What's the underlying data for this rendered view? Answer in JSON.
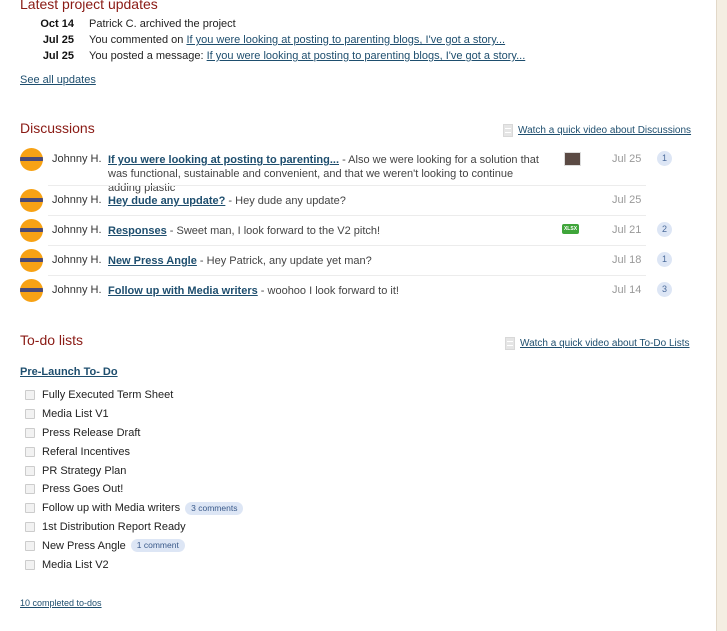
{
  "updates": {
    "title": "Latest project updates",
    "items": [
      {
        "date": "Oct 14",
        "text": "Patrick C. archived the project",
        "link": ""
      },
      {
        "date": "Jul 25",
        "text": "You commented on ",
        "link": "If you were looking at posting to parenting blogs, I've got a story..."
      },
      {
        "date": "Jul 25",
        "text": "You posted a message: ",
        "link": "If you were looking at posting to parenting blogs, I've got a story..."
      }
    ],
    "see_all": "See all updates"
  },
  "discussions": {
    "title": "Discussions",
    "video_link": "Watch a quick video about Discussions",
    "items": [
      {
        "author": "Johnny H.",
        "title": "If you were looking at posting to parenting...",
        "excerpt": " - Also we were looking for a solution that was functional, sustainable and convenient, and that we weren't looking to continue adding plastic",
        "attachment": "image",
        "date": "Jul 25",
        "comments": "1"
      },
      {
        "author": "Johnny H.",
        "title": "Hey dude any update?",
        "excerpt": " - Hey dude any update?",
        "attachment": "",
        "date": "Jul 25",
        "comments": ""
      },
      {
        "author": "Johnny H.",
        "title": "Responses",
        "excerpt": " - Sweet man, I look forward to the V2 pitch!",
        "attachment": "xlsx",
        "date": "Jul 21",
        "comments": "2"
      },
      {
        "author": "Johnny H.",
        "title": "New Press Angle",
        "excerpt": " - Hey Patrick, any update yet man?",
        "attachment": "",
        "date": "Jul 18",
        "comments": "1"
      },
      {
        "author": "Johnny H.",
        "title": "Follow up with Media writers",
        "excerpt": " - woohoo I look forward to it!",
        "attachment": "",
        "date": "Jul 14",
        "comments": "3"
      }
    ],
    "xlsx_label": "XLSX"
  },
  "todos": {
    "title": "To-do lists",
    "video_link": "Watch a quick video about To-Do Lists",
    "list_name": "Pre-Launch To- Do",
    "items": [
      {
        "label": "Fully Executed Term Sheet",
        "badge": ""
      },
      {
        "label": "Media List V1",
        "badge": ""
      },
      {
        "label": "Press Release Draft",
        "badge": ""
      },
      {
        "label": "Referal Incentives",
        "badge": ""
      },
      {
        "label": "PR Strategy Plan",
        "badge": ""
      },
      {
        "label": "Press Goes Out!",
        "badge": ""
      },
      {
        "label": "Follow up with Media writers",
        "badge": "3 comments"
      },
      {
        "label": "1st Distribution Report Ready",
        "badge": ""
      },
      {
        "label": "New Press Angle",
        "badge": "1 comment"
      },
      {
        "label": "Media List V2",
        "badge": ""
      }
    ],
    "completed_link": "10 completed to-dos"
  }
}
